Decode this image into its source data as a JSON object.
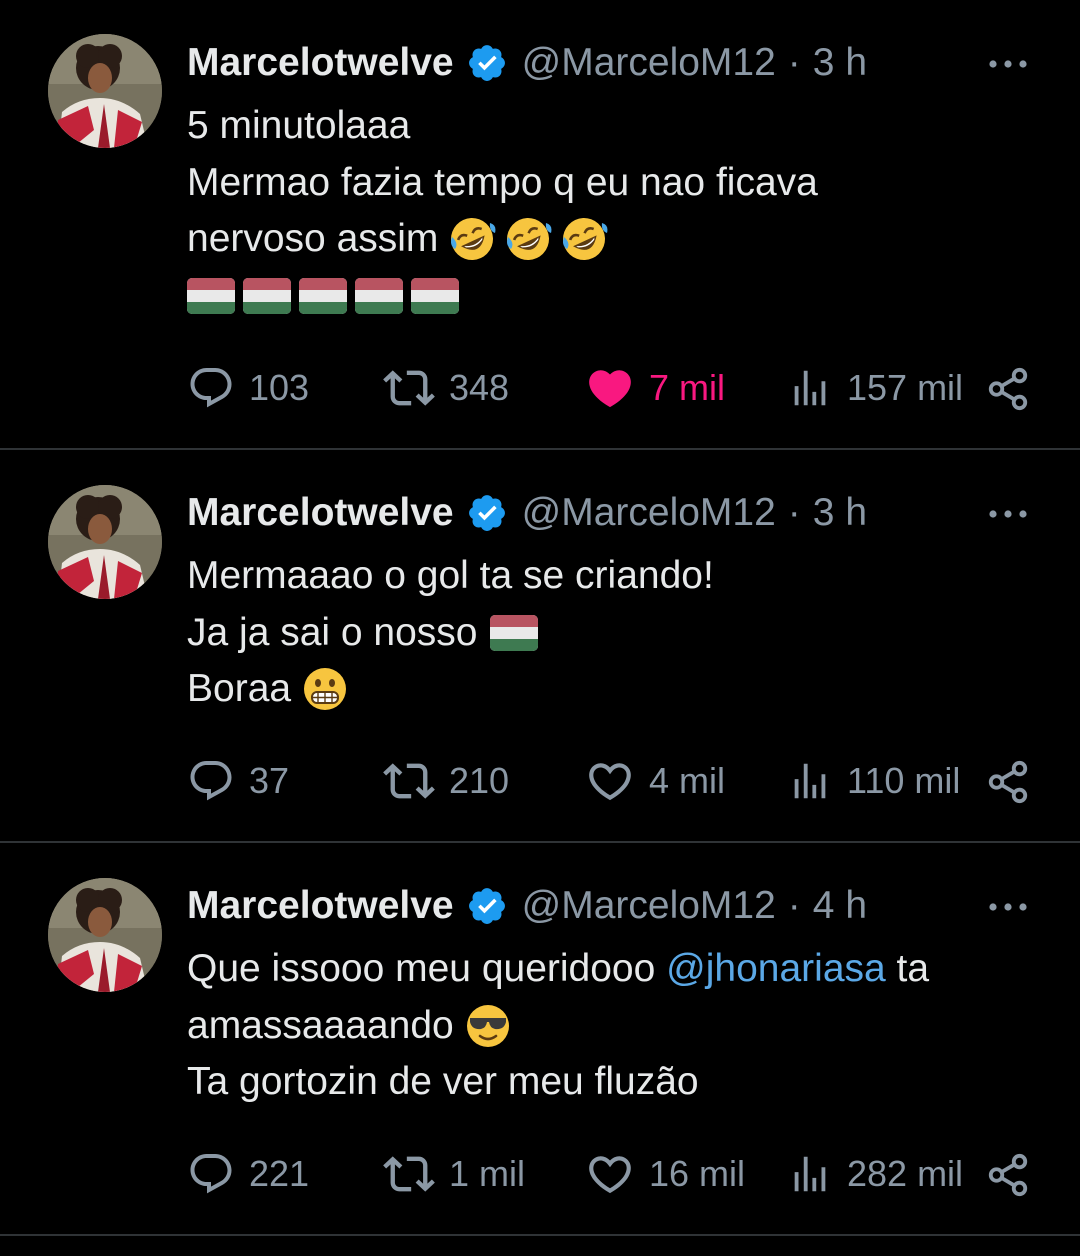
{
  "tweets": [
    {
      "display_name": "Marcelotwelve",
      "handle": "@MarceloM12",
      "time": "3 h",
      "lines": [
        "5 minutolaaa",
        "Mermao fazia tempo q eu nao ficava",
        "nervoso assim"
      ],
      "emojis": [
        "rolling-on-floor-laughing",
        "rolling-on-floor-laughing",
        "rolling-on-floor-laughing"
      ],
      "flags": 5,
      "replies": "103",
      "reposts": "348",
      "likes": "7 mil",
      "liked": true,
      "views": "157 mil"
    },
    {
      "display_name": "Marcelotwelve",
      "handle": "@MarceloM12",
      "time": "3 h",
      "lines": [
        "Mermaaao o gol ta se criando!",
        "Ja ja sai o nosso",
        "Boraa"
      ],
      "emojis": [
        "flag-tricolor",
        "grimacing-face"
      ],
      "replies": "37",
      "reposts": "210",
      "likes": "4 mil",
      "liked": false,
      "views": "110 mil"
    },
    {
      "display_name": "Marcelotwelve",
      "handle": "@MarceloM12",
      "time": "4 h",
      "line1_text": "Que issooo meu queridooo",
      "mention": "@jhonariasa",
      "line1_tail": "ta",
      "line2": "amassaaaando",
      "line3": "Ta gortozin de ver meu fluzão",
      "emojis": [
        "smiling-face-with-sunglasses"
      ],
      "replies": "221",
      "reposts": "1 mil",
      "likes": "16 mil",
      "liked": false,
      "views": "282 mil"
    }
  ],
  "colors": {
    "background": "#000000",
    "text": "#e7e9ea",
    "muted": "#8b98a5",
    "verified": "#1d9bf0",
    "like_active": "#f91880",
    "mention": "#5ba8e6",
    "divider": "#2f3336"
  }
}
